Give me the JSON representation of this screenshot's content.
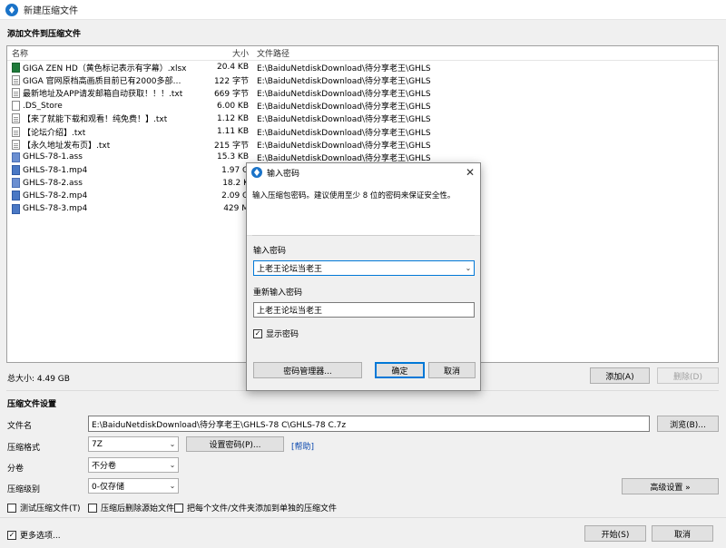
{
  "window": {
    "title": "新建压缩文件"
  },
  "files_section": {
    "label": "添加文件到压缩文件"
  },
  "columns": {
    "name": "名称",
    "size": "大小",
    "path": "文件路径"
  },
  "files": [
    {
      "name": "GIGA ZEN HD（黄色标记表示有字幕）.xlsx",
      "size": "20.4 KB",
      "path": "E:\\BaiduNetdiskDownload\\待分享老王\\GHLS-7...",
      "icon": "excel-icon"
    },
    {
      "name": "GIGA 官网原档高画质目前已有2000多部。其中...",
      "size": "122 字节",
      "path": "E:\\BaiduNetdiskDownload\\待分享老王\\GHLS-7...",
      "icon": "text-file-icon"
    },
    {
      "name": "最新地址及APP请发邮箱自动获取！！！.txt",
      "size": "669 字节",
      "path": "E:\\BaiduNetdiskDownload\\待分享老王\\GHLS-7...",
      "icon": "text-file-icon"
    },
    {
      "name": ".DS_Store",
      "size": "6.00 KB",
      "path": "E:\\BaiduNetdiskDownload\\待分享老王\\GHLS-7...",
      "icon": "blank-file-icon"
    },
    {
      "name": "【来了就能下载和观看！纯免费！】.txt",
      "size": "1.12 KB",
      "path": "E:\\BaiduNetdiskDownload\\待分享老王\\GHLS-7...",
      "icon": "text-file-icon"
    },
    {
      "name": "【论坛介绍】.txt",
      "size": "1.11 KB",
      "path": "E:\\BaiduNetdiskDownload\\待分享老王\\GHLS-7...",
      "icon": "text-file-icon"
    },
    {
      "name": "【永久地址发布页】.txt",
      "size": "215 字节",
      "path": "E:\\BaiduNetdiskDownload\\待分享老王\\GHLS-7...",
      "icon": "text-file-icon"
    },
    {
      "name": "GHLS-78-1.ass",
      "size": "15.3 KB",
      "path": "E:\\BaiduNetdiskDownload\\待分享老王\\GHLS-7...",
      "icon": "subtitle-file-icon"
    },
    {
      "name": "GHLS-78-1.mp4",
      "size": "1.97 G",
      "path": "",
      "icon": "video-file-icon"
    },
    {
      "name": "GHLS-78-2.ass",
      "size": "18.2 K",
      "path": "",
      "icon": "subtitle-file-icon"
    },
    {
      "name": "GHLS-78-2.mp4",
      "size": "2.09 G",
      "path": "",
      "icon": "video-file-icon"
    },
    {
      "name": "GHLS-78-3.mp4",
      "size": "429 M",
      "path": "",
      "icon": "video-file-icon"
    }
  ],
  "total_size": "总大小: 4.49 GB",
  "buttons": {
    "add": "添加(A)",
    "delete": "删除(D)",
    "browse": "浏览(B)...",
    "set_password": "设置密码(P)...",
    "advanced": "高级设置 »",
    "start": "开始(S)",
    "cancel": "取消"
  },
  "help_link": "[帮助]",
  "settings": {
    "section_label": "压缩文件设置",
    "filename_label": "文件名",
    "filename_value": "E:\\BaiduNetdiskDownload\\待分享老王\\GHLS-78 C\\GHLS-78 C.7z",
    "format_label": "压缩格式",
    "format_value": "7Z",
    "split_label": "分卷",
    "split_value": "不分卷",
    "level_label": "压缩级别",
    "level_value": "0-仅存储"
  },
  "options": {
    "test": "测试压缩文件(T)",
    "delete_source": "压缩后删除源始文件",
    "separate": "把每个文件/文件夹添加到单独的压缩文件",
    "more": "更多选项..."
  },
  "dialog": {
    "title": "输入密码",
    "description": "输入压缩包密码。建议使用至少 8 位的密码来保证安全性。",
    "password_label": "输入密码",
    "password_value": "上老王论坛当老王",
    "confirm_label": "重新输入密码",
    "confirm_value": "上老王论坛当老王",
    "show_password": "显示密码",
    "manager_button": "密码管理器...",
    "ok_button": "确定",
    "cancel_button": "取消"
  },
  "colors": {
    "accent": "#0078d7",
    "link": "#0645ad"
  }
}
